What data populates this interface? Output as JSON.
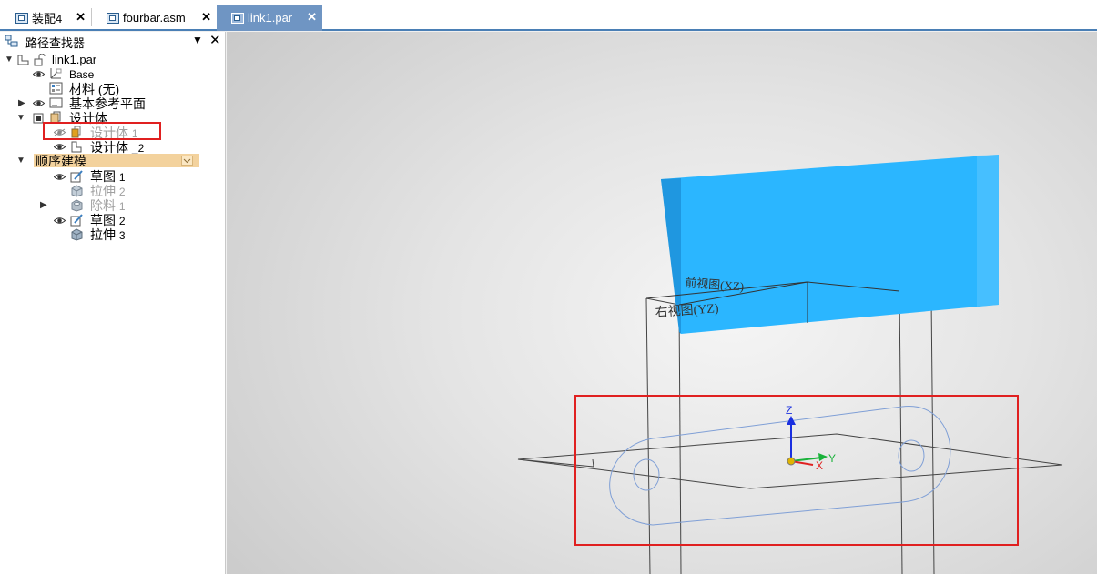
{
  "tabs": [
    {
      "label": "装配4",
      "close": "✕",
      "active": false
    },
    {
      "label": "fourbar.asm",
      "close": "✕",
      "active": false
    },
    {
      "label": "link1.par",
      "close": "✕",
      "active": true
    }
  ],
  "pathfinder": {
    "title": "路径查找器",
    "pin": "▼",
    "close": "✕",
    "root": "link1.par",
    "items": {
      "base": "Base",
      "material": "材料 (无)",
      "ref_planes": "基本参考平面",
      "design_bodies": "设计体",
      "body1_label": "设计体",
      "body1_num": "1",
      "body2_label": "设计体",
      "body2_num": "_2",
      "ordered": "顺序建模",
      "sketch1_label": "草图",
      "sketch1_num": "1",
      "extrude2_label": "拉伸",
      "extrude2_num": "2",
      "cut1_label": "除料",
      "cut1_num": "1",
      "sketch2_label": "草图",
      "sketch2_num": "2",
      "extrude3_label": "拉伸",
      "extrude3_num": "3"
    }
  },
  "viewport": {
    "front_view_label": "前视图(XZ)",
    "right_view_label": "右视图(YZ)",
    "axis_z": "Z",
    "axis_y": "Y",
    "axis_x": "X"
  },
  "colors": {
    "accent": "#6f95c3",
    "body_blue": "#2bb6ff",
    "highlight_red": "#e02020",
    "selected_row": "#f3d29d"
  }
}
